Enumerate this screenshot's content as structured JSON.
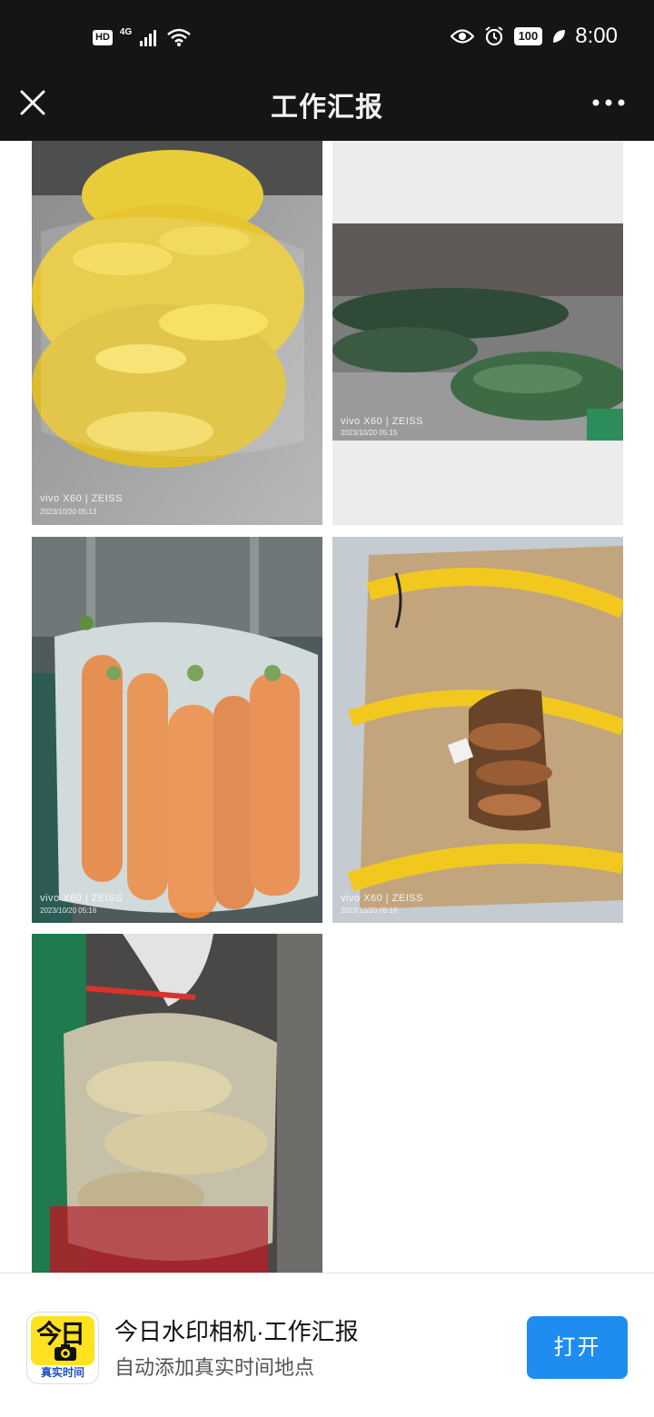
{
  "status_bar": {
    "hd": "HD",
    "network": "4G",
    "battery": "100",
    "time": "8:00",
    "icons": [
      "signal-icon",
      "wifi-icon",
      "eye-icon",
      "alarm-icon",
      "battery-icon",
      "leaf-icon"
    ]
  },
  "header": {
    "title": "工作汇报",
    "close_icon": "close-icon",
    "more_icon": "more-icon"
  },
  "photos": [
    {
      "subject": "corn",
      "brand": "vivo X60 | ZEISS",
      "date": "2023/10/20 05:13"
    },
    {
      "subject": "winter-melon",
      "brand": "vivo X60 | ZEISS",
      "date": "2023/10/20 05:15"
    },
    {
      "subject": "carrots",
      "brand": "vivo X60 | ZEISS",
      "date": "2023/10/20 05:16"
    },
    {
      "subject": "sweet-potatoes",
      "brand": "vivo X60 | ZEISS",
      "date": "2023/10/20 05:16"
    },
    {
      "subject": "ginger",
      "brand": "",
      "date": ""
    }
  ],
  "promo": {
    "app_icon_text": "今日",
    "app_icon_sub": "真实时间",
    "title": "今日水印相机·工作汇报",
    "subtitle": "自动添加真实时间地点",
    "open_label": "打开"
  },
  "colors": {
    "bar_bg": "#151515",
    "accent": "#1f8cf0",
    "icon_yellow": "#ffe21f"
  }
}
